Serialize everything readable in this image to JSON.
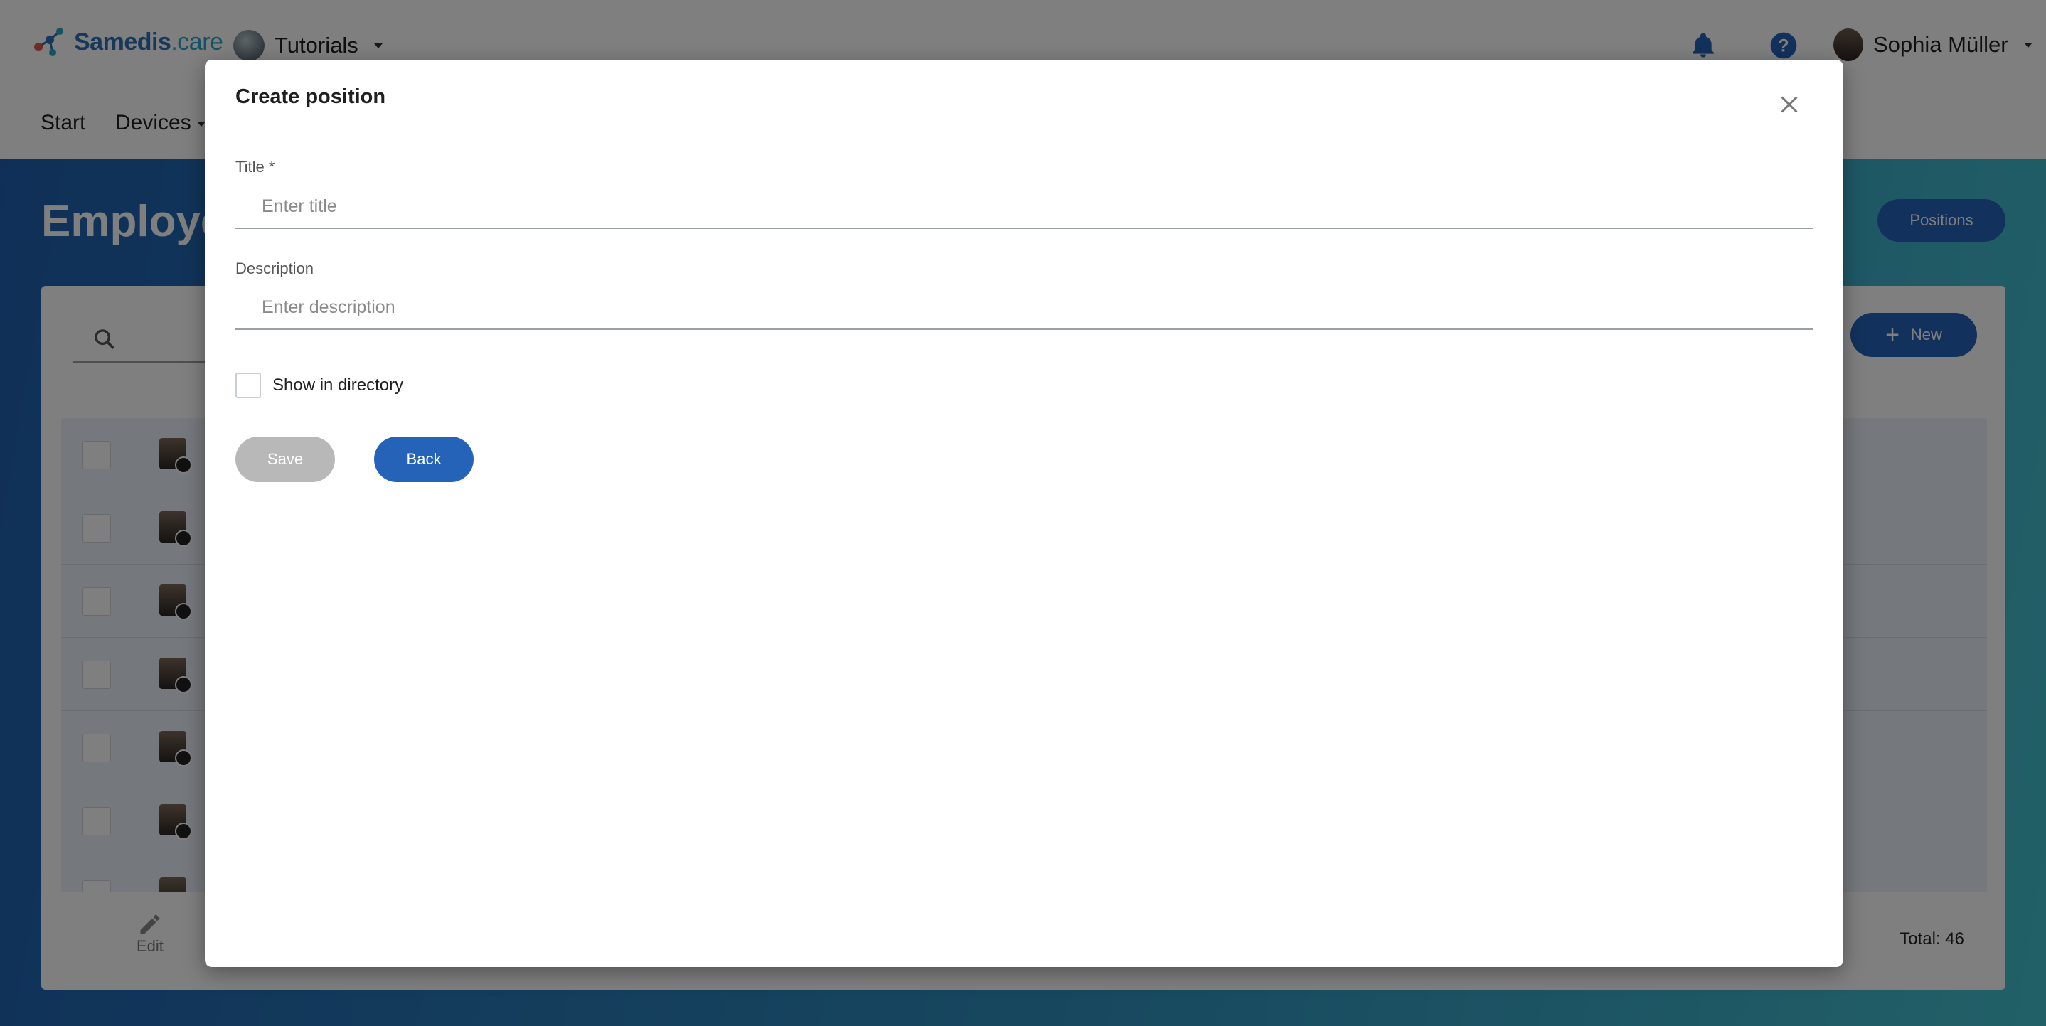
{
  "app": {
    "brand_main": "Samedis",
    "brand_suffix": ".care",
    "tenant": "Tutorials",
    "user_name": "Sophia Müller"
  },
  "nav": {
    "items": [
      "Start",
      "Devices"
    ]
  },
  "page": {
    "title": "Employees",
    "positions_button": "Positions",
    "new_button": "New",
    "edit_label": "Edit",
    "total": "Total: 46"
  },
  "modal": {
    "title": "Create position",
    "title_field": {
      "label": "Title *",
      "placeholder": "Enter title",
      "value": ""
    },
    "description_field": {
      "label": "Description",
      "placeholder": "Enter description",
      "value": ""
    },
    "show_in_directory": {
      "label": "Show in directory",
      "checked": false
    },
    "save_label": "Save",
    "back_label": "Back"
  },
  "colors": {
    "primary": "#2563b8",
    "disabled": "#b8b8b8",
    "brand": "#2f6fb7"
  }
}
